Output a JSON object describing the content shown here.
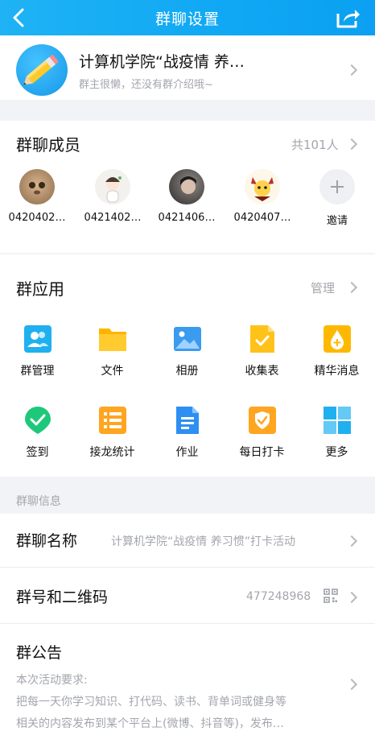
{
  "header": {
    "title": "群聊设置"
  },
  "group": {
    "name": "计算机学院“战疫情 养…",
    "description": "群主很懒，还没有群介绍哦~"
  },
  "members": {
    "title": "群聊成员",
    "count": "共101人",
    "items": [
      {
        "name": "0420402…"
      },
      {
        "name": "0421402…"
      },
      {
        "name": "0421406…"
      },
      {
        "name": "0420407…"
      }
    ],
    "invite_label": "邀请"
  },
  "apps": {
    "title": "群应用",
    "manage_label": "管理",
    "items": [
      {
        "label": "群管理",
        "icon": "group-manage-icon"
      },
      {
        "label": "文件",
        "icon": "folder-icon"
      },
      {
        "label": "相册",
        "icon": "album-icon"
      },
      {
        "label": "收集表",
        "icon": "form-icon"
      },
      {
        "label": "精华消息",
        "icon": "essence-icon"
      },
      {
        "label": "签到",
        "icon": "checkin-icon"
      },
      {
        "label": "接龙统计",
        "icon": "solitaire-icon"
      },
      {
        "label": "作业",
        "icon": "homework-icon"
      },
      {
        "label": "每日打卡",
        "icon": "daily-clock-icon"
      },
      {
        "label": "更多",
        "icon": "more-grid-icon"
      }
    ]
  },
  "info": {
    "section_label": "群聊信息",
    "name_title": "群聊名称",
    "name_value": "计算机学院“战疫情 养习惯”打卡活动",
    "number_title": "群号和二维码",
    "number_value": "477248968",
    "notice_title": "群公告",
    "notice_lines": [
      "本次活动要求:",
      "把每一天你学习知识、打代码、读书、背单词或健身等",
      "相关的内容发布到某个平台上(微博、抖音等)，发布…"
    ]
  },
  "colors": {
    "header": "#10a8f4",
    "secondary_text": "#a3a6ad",
    "page_bg": "#f2f3f7"
  }
}
